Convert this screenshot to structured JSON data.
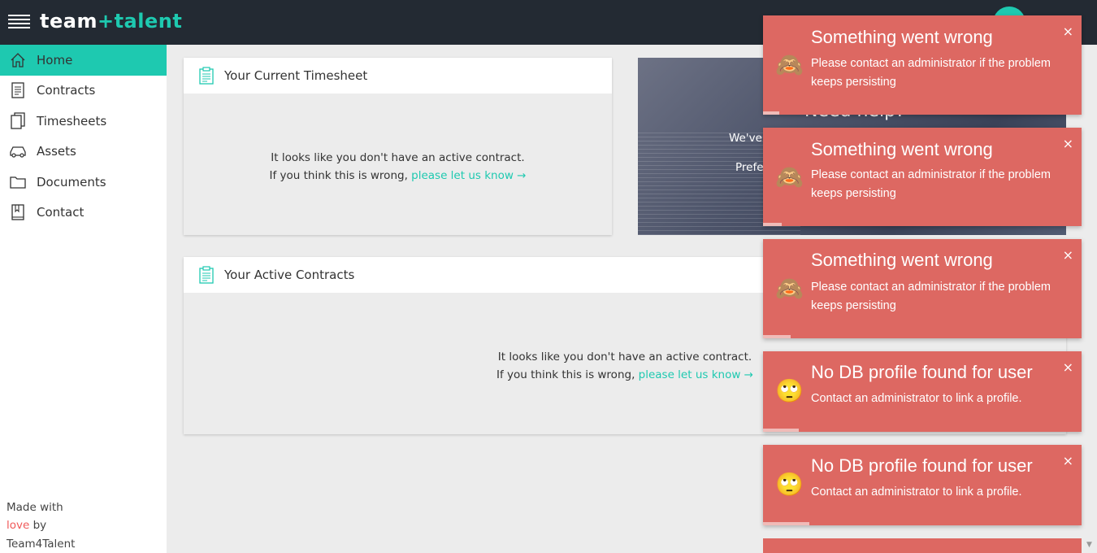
{
  "header": {
    "logo": {
      "team": "team",
      "plus": "+",
      "talent": "talent"
    },
    "menu_icon": "hamburger-icon",
    "avatar_color": "#1ec9b0",
    "caret": "▾"
  },
  "sidebar": {
    "items": [
      {
        "label": "Home",
        "icon": "home-icon",
        "active": true
      },
      {
        "label": "Contracts",
        "icon": "contract-icon",
        "active": false
      },
      {
        "label": "Timesheets",
        "icon": "timesheet-icon",
        "active": false
      },
      {
        "label": "Assets",
        "icon": "car-icon",
        "active": false
      },
      {
        "label": "Documents",
        "icon": "folder-icon",
        "active": false
      },
      {
        "label": "Contact",
        "icon": "contact-book-icon",
        "active": false
      }
    ],
    "footer": {
      "made_with": "Made with",
      "love": "love",
      "by": "by",
      "company": "Team4Talent"
    }
  },
  "timesheet_card": {
    "title": "Your Current Timesheet",
    "line1": "It looks like you don't have an active contract.",
    "line2_prefix": "If you think this is wrong,",
    "link": "please let us know →"
  },
  "contracts_card": {
    "title": "Your Active Contracts",
    "line1": "It looks like you don't have an active contract.",
    "line2_prefix": "If you think this is wrong,",
    "link": "please let us know →"
  },
  "help_card": {
    "title": "Need help?",
    "line1": "We've",
    "line2": "Prefe"
  },
  "toasts": [
    {
      "title": "Something went wrong",
      "message": "Please contact an administrator if the problem keeps persisting",
      "emoji": "🙈",
      "close": "×"
    },
    {
      "title": "Something went wrong",
      "message": "Please contact an administrator if the problem keeps persisting",
      "emoji": "🙈",
      "close": "×"
    },
    {
      "title": "Something went wrong",
      "message": "Please contact an administrator if the problem keeps persisting",
      "emoji": "🙈",
      "close": "×"
    },
    {
      "title": "No DB profile found for user",
      "message": "Contact an administrator to link a profile.",
      "emoji": "🙄",
      "close": "×"
    },
    {
      "title": "No DB profile found for user",
      "message": "Contact an administrator to link a profile.",
      "emoji": "🙄",
      "close": "×"
    }
  ],
  "colors": {
    "accent": "#1ec9b0",
    "topbar": "#232a33",
    "toast": "#dd6862"
  }
}
